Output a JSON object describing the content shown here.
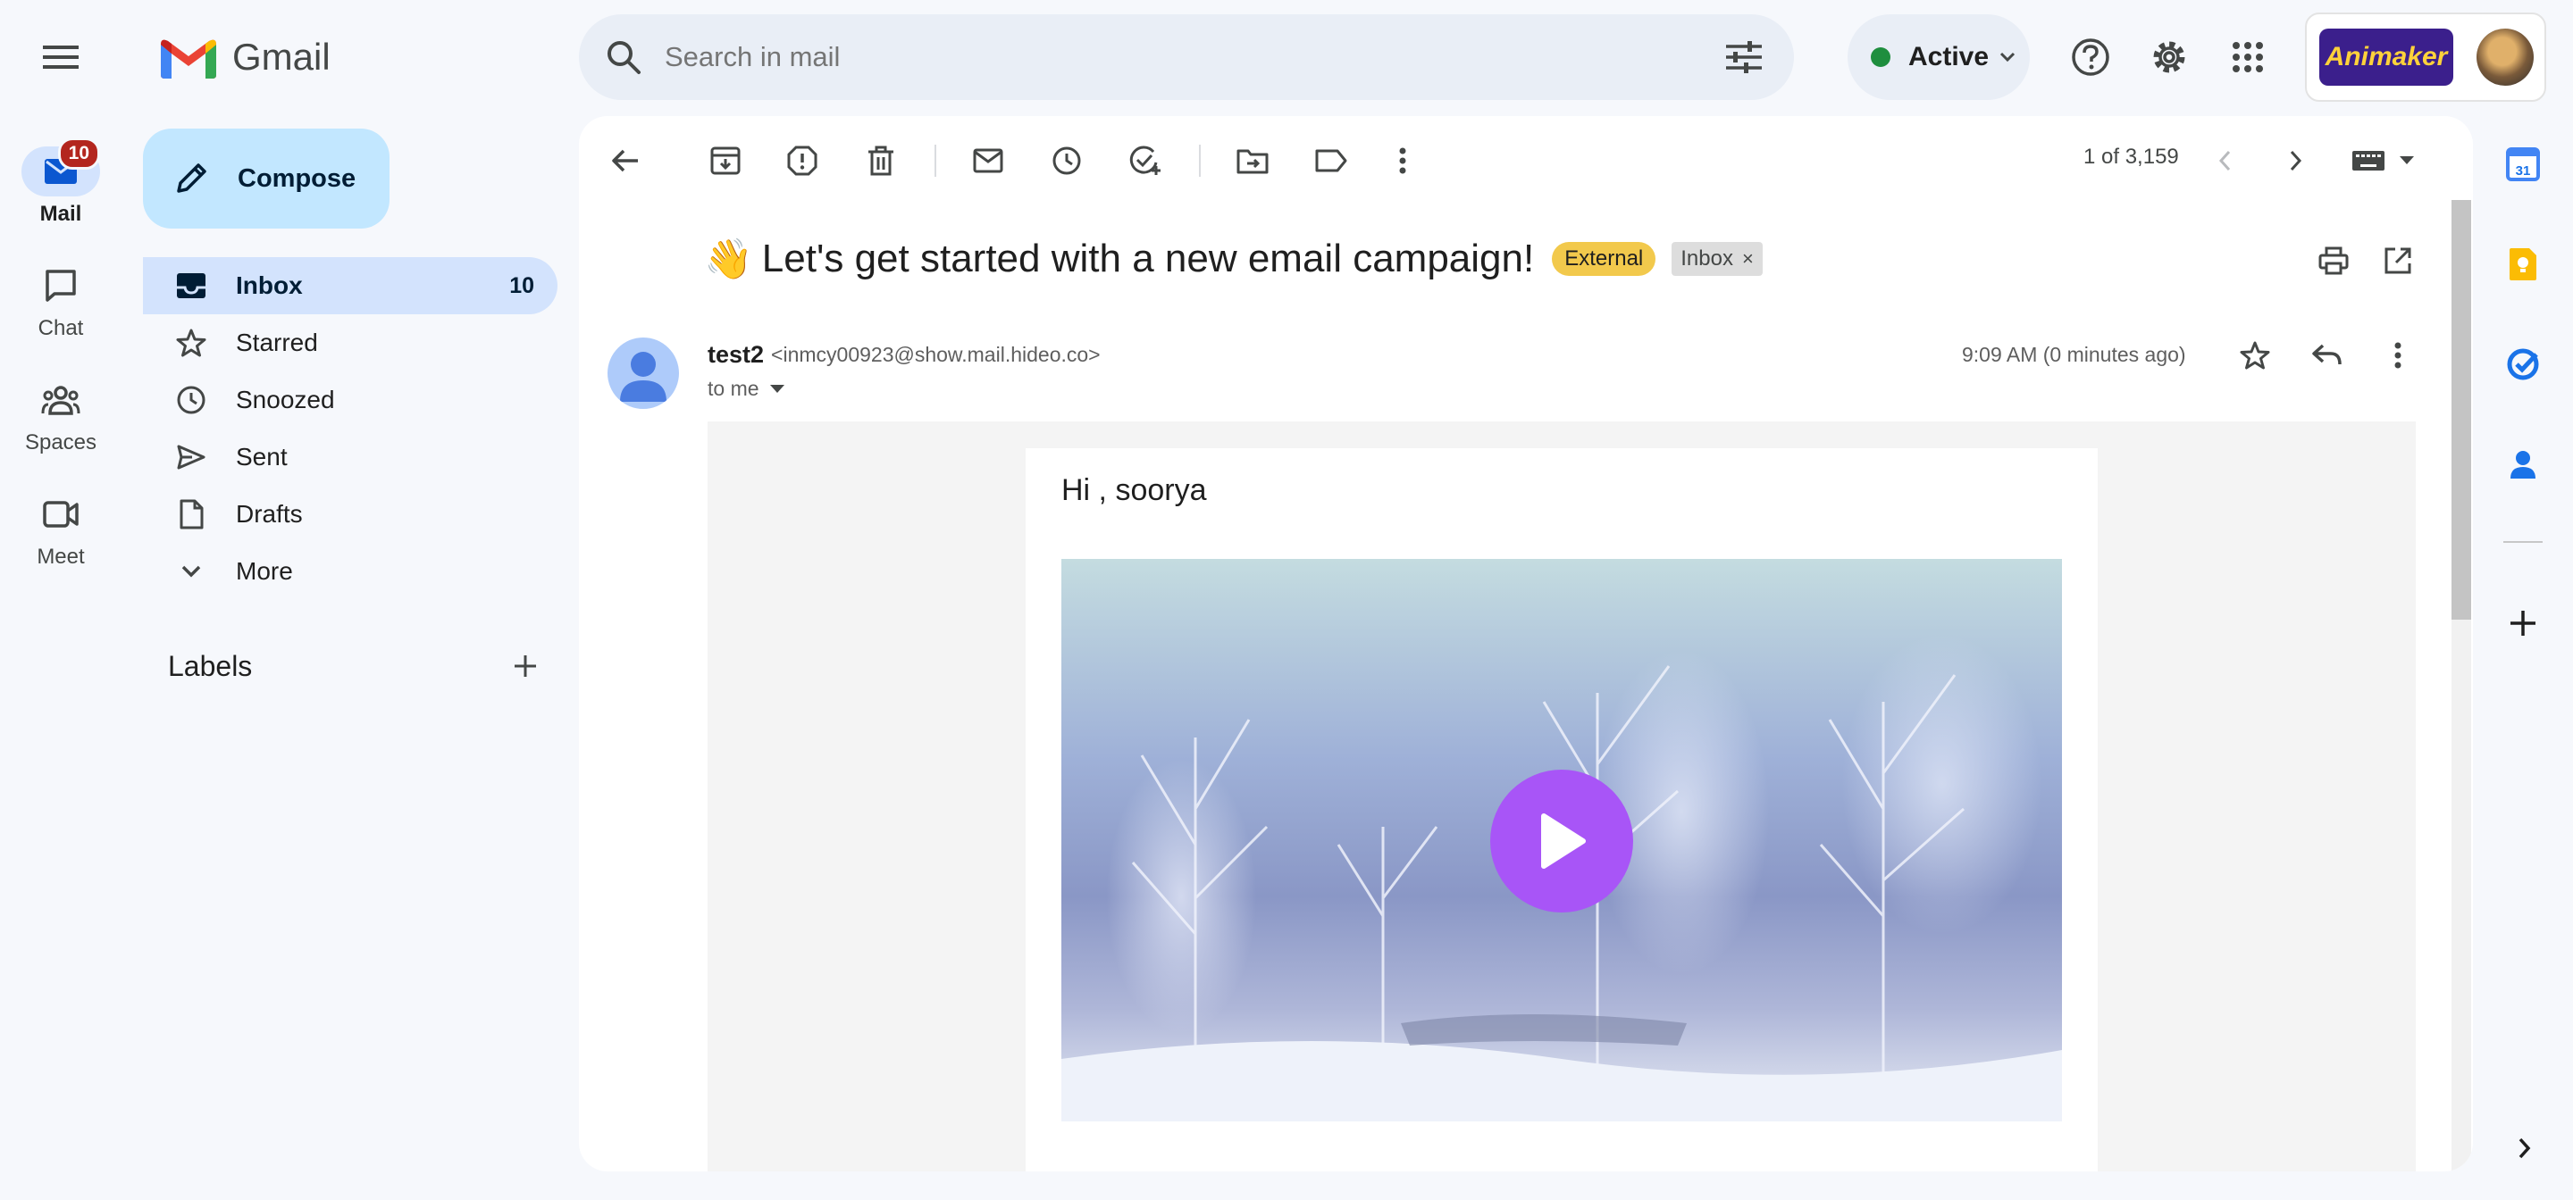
{
  "app": {
    "name": "Gmail",
    "menu_icon": "hamburger-menu-icon"
  },
  "search": {
    "placeholder": "Search in mail"
  },
  "status": {
    "label": "Active",
    "color": "#1e8e3e"
  },
  "account": {
    "brand": "Animaker"
  },
  "rail": [
    {
      "label": "Mail",
      "icon": "mail-icon",
      "badge": "10",
      "active": true
    },
    {
      "label": "Chat",
      "icon": "chat-icon"
    },
    {
      "label": "Spaces",
      "icon": "spaces-icon"
    },
    {
      "label": "Meet",
      "icon": "meet-icon"
    }
  ],
  "compose": {
    "label": "Compose"
  },
  "nav": [
    {
      "label": "Inbox",
      "icon": "inbox-icon",
      "count": "10",
      "active": true
    },
    {
      "label": "Starred",
      "icon": "star-icon"
    },
    {
      "label": "Snoozed",
      "icon": "clock-icon"
    },
    {
      "label": "Sent",
      "icon": "send-icon"
    },
    {
      "label": "Drafts",
      "icon": "draft-icon"
    },
    {
      "label": "More",
      "icon": "chevron-down-icon"
    }
  ],
  "labels": {
    "title": "Labels"
  },
  "toolbar": {
    "pagination": "1 of 3,159"
  },
  "email": {
    "emoji": "👋",
    "subject": "Let's get started with a new email campaign!",
    "chips": {
      "external": "External",
      "inbox": "Inbox"
    },
    "sender_name": "test2",
    "sender_email": "<inmcy00923@show.mail.hideo.co>",
    "recipient": "to me",
    "time": "9:09 AM (0 minutes ago)",
    "greeting": "Hi , soorya"
  },
  "colors": {
    "accent": "#0b57d0",
    "compose_bg": "#c2e7ff",
    "active_nav": "#d3e3fd",
    "badge": "#b3261e",
    "external_chip": "#f2c94c",
    "play_button": "#a855f7"
  }
}
